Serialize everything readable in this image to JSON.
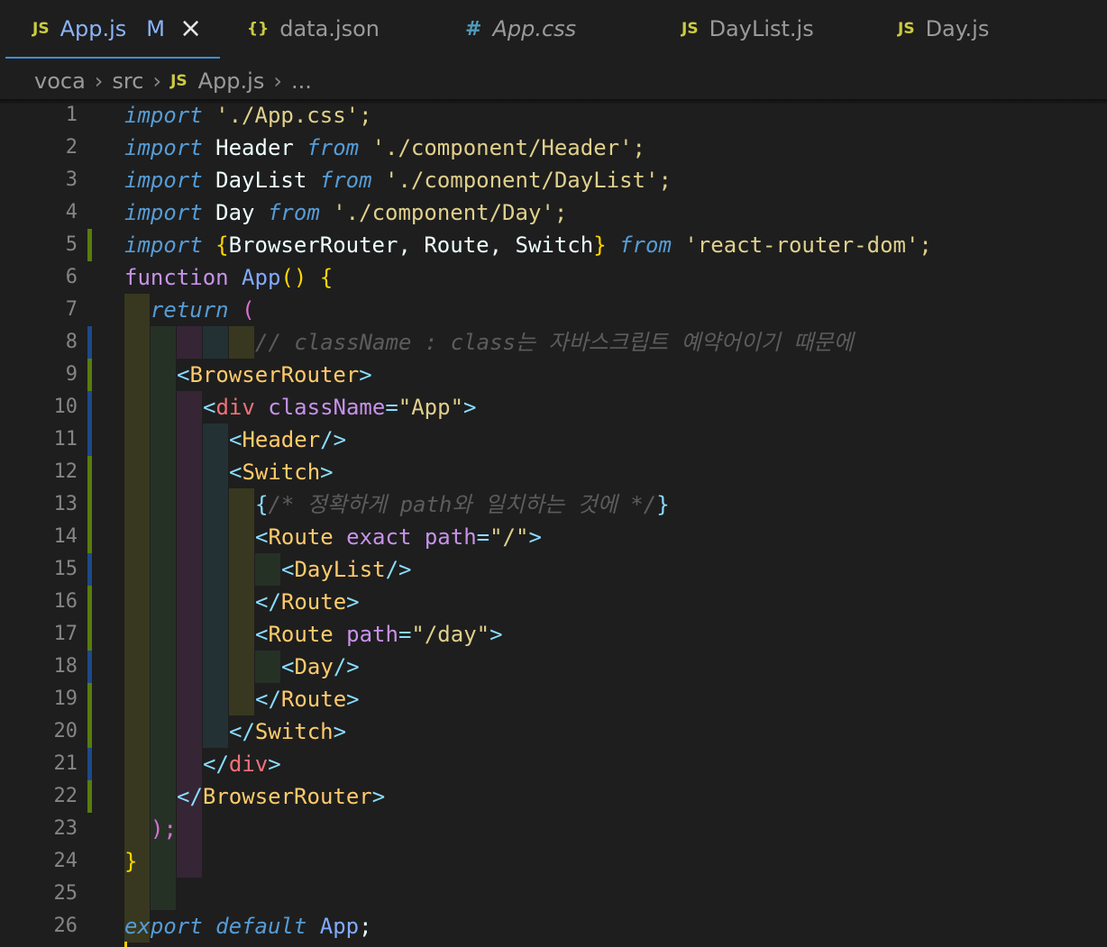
{
  "tabs": [
    {
      "icon": "JS",
      "label": "App.js",
      "modified": "M",
      "active": true
    },
    {
      "icon": "{}",
      "label": "data.json"
    },
    {
      "icon": "#",
      "label": "App.css"
    },
    {
      "icon": "JS",
      "label": "DayList.js"
    },
    {
      "icon": "JS",
      "label": "Day.js"
    }
  ],
  "breadcrumb": {
    "root": "voca",
    "folder": "src",
    "file_icon": "JS",
    "file": "App.js",
    "more": "..."
  },
  "code": {
    "l1": {
      "kw": "import",
      "str": "'./App.css';"
    },
    "l2": {
      "kw": "import",
      "id": "Header",
      "from": "from",
      "str": "'./component/Header';"
    },
    "l3": {
      "kw": "import",
      "id": "DayList",
      "from": "from",
      "str": "'./component/DayList';"
    },
    "l4": {
      "kw": "import",
      "id": "Day",
      "from": "from",
      "str": "'./component/Day';"
    },
    "l5": {
      "kw": "import",
      "ob": "{",
      "ids": "BrowserRouter, Route, Switch",
      "cb": "}",
      "from": "from",
      "str": "'react-router-dom';"
    },
    "l6": {
      "kw": "function",
      "name": "App",
      "parens": "()",
      "brace": "{"
    },
    "l7": {
      "kw": "return",
      "paren": "("
    },
    "l8": {
      "comment": "// className : class는 자바스크립트 예약어이기 때문에"
    },
    "l9": {
      "tag": "BrowserRouter"
    },
    "l10": {
      "tag": "div",
      "attr": "className",
      "value": "\"App\""
    },
    "l11": {
      "tag": "Header"
    },
    "l12": {
      "tag": "Switch"
    },
    "l13": {
      "comment": "/* 정확하게 path와 일치하는 것에 */"
    },
    "l14": {
      "tag": "Route",
      "attr1": "exact",
      "attr2": "path",
      "value": "\"/\""
    },
    "l15": {
      "tag": "DayList"
    },
    "l16": {
      "tag": "Route"
    },
    "l17": {
      "tag": "Route",
      "attr": "path",
      "value": "\"/day\""
    },
    "l18": {
      "tag": "Day"
    },
    "l19": {
      "tag": "Route"
    },
    "l20": {
      "tag": "Switch"
    },
    "l21": {
      "tag": "div"
    },
    "l22": {
      "tag": "BrowserRouter"
    },
    "l23": {
      "text": ");"
    },
    "l24": {
      "text": "}"
    },
    "l26": {
      "kw1": "export",
      "kw2": "default",
      "name": "App",
      "semi": ";"
    }
  },
  "line_numbers": [
    "1",
    "2",
    "3",
    "4",
    "5",
    "6",
    "7",
    "8",
    "9",
    "10",
    "11",
    "12",
    "13",
    "14",
    "15",
    "16",
    "17",
    "18",
    "19",
    "20",
    "21",
    "22",
    "23",
    "24",
    "25",
    "26"
  ],
  "colors": {
    "background": "#1e1e1e",
    "keyword": "#569cd6",
    "string": "#ce9178",
    "component_tag": "#ffcb6b",
    "html_tag": "#f07178",
    "attribute": "#c792ea",
    "comment": "#5c5c5c",
    "active_tab": "#8ab4f8",
    "gutter_added": "#587c0c",
    "gutter_modified": "#1b4a8a"
  }
}
